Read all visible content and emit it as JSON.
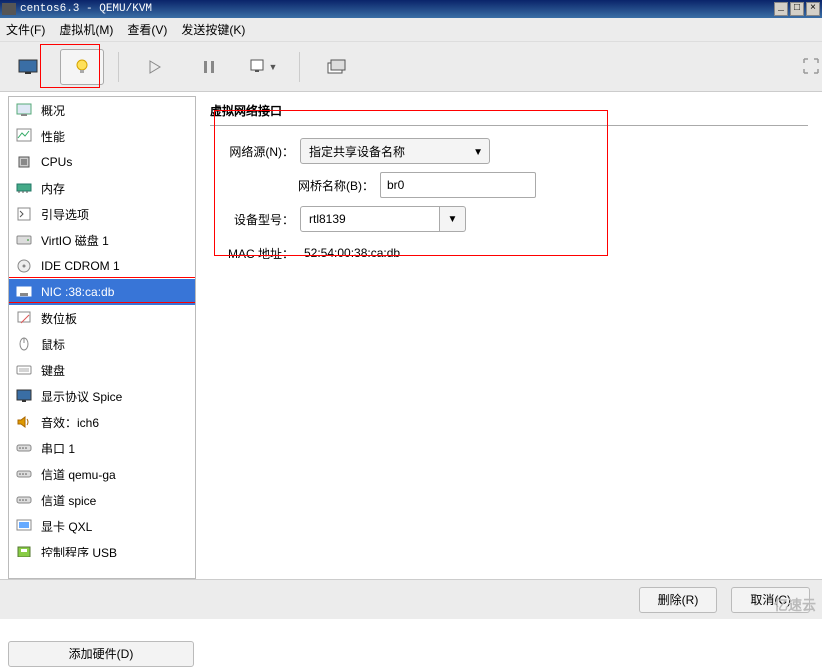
{
  "window": {
    "title": "centos6.3 - QEMU/KVM"
  },
  "menu": {
    "file": "文件(F)",
    "vm": "虚拟机(M)",
    "view": "查看(V)",
    "sendkey": "发送按键(K)"
  },
  "sidebar": {
    "items": [
      {
        "label": "概况",
        "icon": "overview"
      },
      {
        "label": "性能",
        "icon": "perf"
      },
      {
        "label": "CPUs",
        "icon": "cpu"
      },
      {
        "label": "内存",
        "icon": "mem"
      },
      {
        "label": "引导选项",
        "icon": "boot"
      },
      {
        "label": "VirtIO 磁盘 1",
        "icon": "hdd"
      },
      {
        "label": "IDE CDROM 1",
        "icon": "cd"
      },
      {
        "label": "NIC :38:ca:db",
        "icon": "nic",
        "selected": true
      },
      {
        "label": "数位板",
        "icon": "tablet"
      },
      {
        "label": "鼠标",
        "icon": "mouse"
      },
      {
        "label": "键盘",
        "icon": "kbd"
      },
      {
        "label": "显示协议 Spice",
        "icon": "display"
      },
      {
        "label": "音效：ich6",
        "icon": "sound"
      },
      {
        "label": "串口 1",
        "icon": "serial"
      },
      {
        "label": "信道 qemu-ga",
        "icon": "serial"
      },
      {
        "label": "信道 spice",
        "icon": "serial"
      },
      {
        "label": "显卡 QXL",
        "icon": "video"
      },
      {
        "label": "控制程序 USB",
        "icon": "usb"
      }
    ],
    "add_hw": "添加硬件(D)"
  },
  "panel": {
    "title": "虚拟网络接口",
    "net_source_label": "网络源(N)：",
    "net_source_value": "指定共享设备名称",
    "bridge_label": "网桥名称(B)：",
    "bridge_value": "br0",
    "device_model_label": "设备型号：",
    "device_model_value": "rtl8139",
    "mac_label": "MAC 地址：",
    "mac_value": "52:54:00:38:ca:db"
  },
  "buttons": {
    "delete": "删除(R)",
    "cancel": "取消(C)"
  },
  "watermark": "亿速云"
}
